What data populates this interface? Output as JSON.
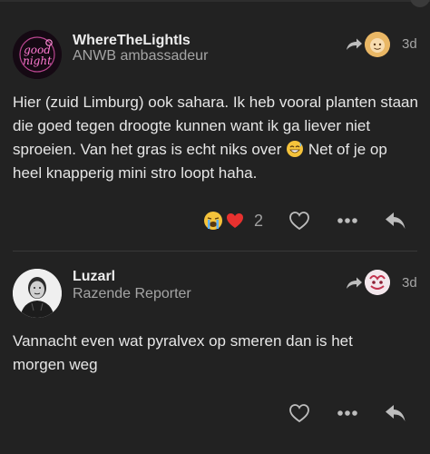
{
  "posts": [
    {
      "username": "WhereTheLightIs",
      "user_title": "ANWB ambassadeur",
      "age": "3d",
      "avatar_icon": "good-night-neon-avatar-icon",
      "avatar_text_line1": "good",
      "avatar_text_line2": "night",
      "body_before_emoji": "Hier (zuid Limburg) ook sahara. Ik heb vooral planten staan die goed tegen droogte kunnen want ik ga liever niet sproeien. Van het gras is echt niks over ",
      "body_emoji": "grinning-sweat-emoji",
      "body_after_emoji": " Net of je op heel knapperig mini stro loopt haha.",
      "reactions": [
        "crying-face-emoji",
        "red-heart-emoji"
      ],
      "like_count": "2"
    },
    {
      "username": "Luzarl",
      "user_title": "Razende Reporter",
      "age": "3d",
      "avatar_icon": "portrait-avatar-icon",
      "body_text": "Vannacht even wat pyralvex op smeren dan is het morgen weg"
    }
  ],
  "colors": {
    "background": "#222222",
    "text": "#e6e6e6",
    "muted": "#a5a5a5",
    "divider": "#383838",
    "icon": "#bdbdbd",
    "neon_pink": "#ff5fc4"
  }
}
